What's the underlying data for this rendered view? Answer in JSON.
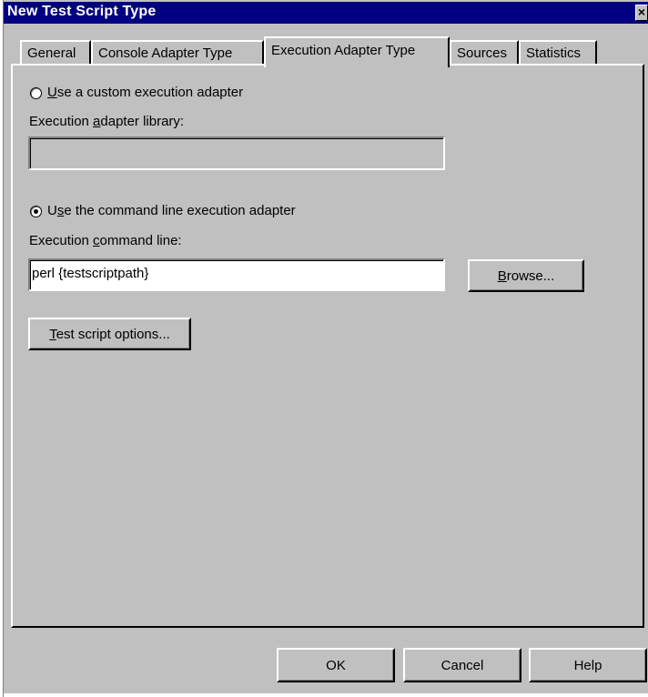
{
  "window": {
    "title": "New Test Script Type",
    "close_glyph": "×"
  },
  "tabs": [
    {
      "label": "General"
    },
    {
      "label": "Console Adapter Type"
    },
    {
      "label": "Execution Adapter Type",
      "active": true
    },
    {
      "label": "Sources"
    },
    {
      "label": "Statistics"
    }
  ],
  "execution": {
    "custom_radio": {
      "pre": "",
      "key": "U",
      "post": "se a custom execution adapter",
      "checked": false
    },
    "library_label": {
      "pre": "Execution ",
      "key": "a",
      "post": "dapter library:"
    },
    "library_value": "",
    "cmdline_radio": {
      "pre": "U",
      "key": "s",
      "post": "e the command line execution adapter",
      "checked": true
    },
    "cmdline_label": {
      "pre": "Execution ",
      "key": "c",
      "post": "ommand line:"
    },
    "cmdline_value": "perl {testscriptpath}",
    "browse_button": {
      "pre": "",
      "key": "B",
      "post": "rowse..."
    },
    "options_button": {
      "pre": "",
      "key": "T",
      "post": "est script options..."
    }
  },
  "footer": {
    "ok": "OK",
    "cancel": "Cancel",
    "help": "Help"
  }
}
